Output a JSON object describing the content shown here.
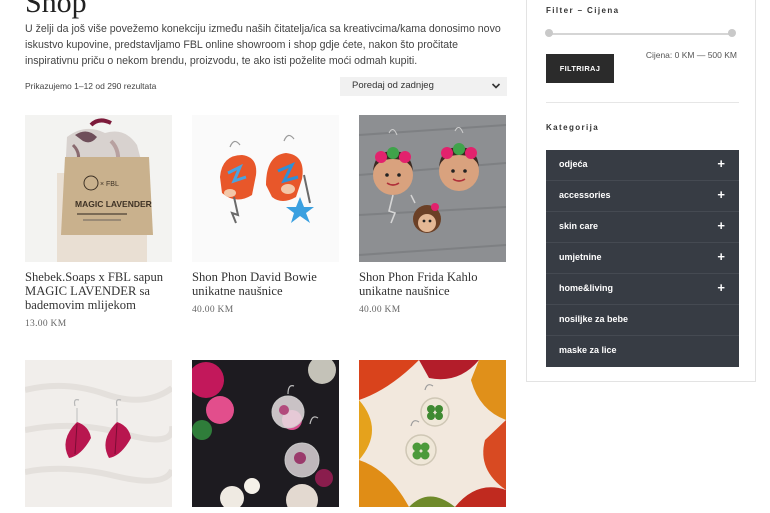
{
  "page": {
    "title": "Shop",
    "intro": "U želji da još više povežemo konekciju između naših čitatelja/ica sa kreativcima/kama donosimo novo iskustvo kupovine, predstavljamo FBL online showroom i shop gdje ćete, nakon što pročitate inspirativnu priču o nekom brendu, proizvodu, te ako isti poželite moći odmah kupiti.",
    "result_count": "Prikazujemo 1–12 od 290 rezultata",
    "sort_selected": "Poredaj od zadnjeg"
  },
  "products": [
    {
      "name": "Shebek.Soaps x FBL sapun MAGIC LAVENDER sa bademovim mlijekom",
      "price": "13.00 KM",
      "soap_text": "MAGIC LAVENDER",
      "soap_brand": "× FBL"
    },
    {
      "name": "Shon Phon David Bowie unikatne naušnice",
      "price": "40.00 KM"
    },
    {
      "name": "Shon Phon Frida Kahlo unikatne naušnice",
      "price": "40.00 KM"
    },
    {
      "name": "",
      "price": ""
    },
    {
      "name": "",
      "price": ""
    },
    {
      "name": "",
      "price": ""
    }
  ],
  "sidebar": {
    "filter_title": "Filter – Cijena",
    "filter_button": "FILTRIRAJ",
    "price_range": "Cijena: 0 KM — 500 KM",
    "categories_title": "Kategorija",
    "categories": [
      {
        "label": "odjeća",
        "expandable": true
      },
      {
        "label": "accessories",
        "expandable": true
      },
      {
        "label": "skin care",
        "expandable": true
      },
      {
        "label": "umjetnine",
        "expandable": true
      },
      {
        "label": "home&living",
        "expandable": true
      },
      {
        "label": "nosiljke za bebe",
        "expandable": false
      },
      {
        "label": "maske za lice",
        "expandable": false
      }
    ],
    "expand_symbol": "+"
  },
  "colors": {
    "category_bg": "#373c44",
    "button_bg": "#2b2b2b"
  }
}
